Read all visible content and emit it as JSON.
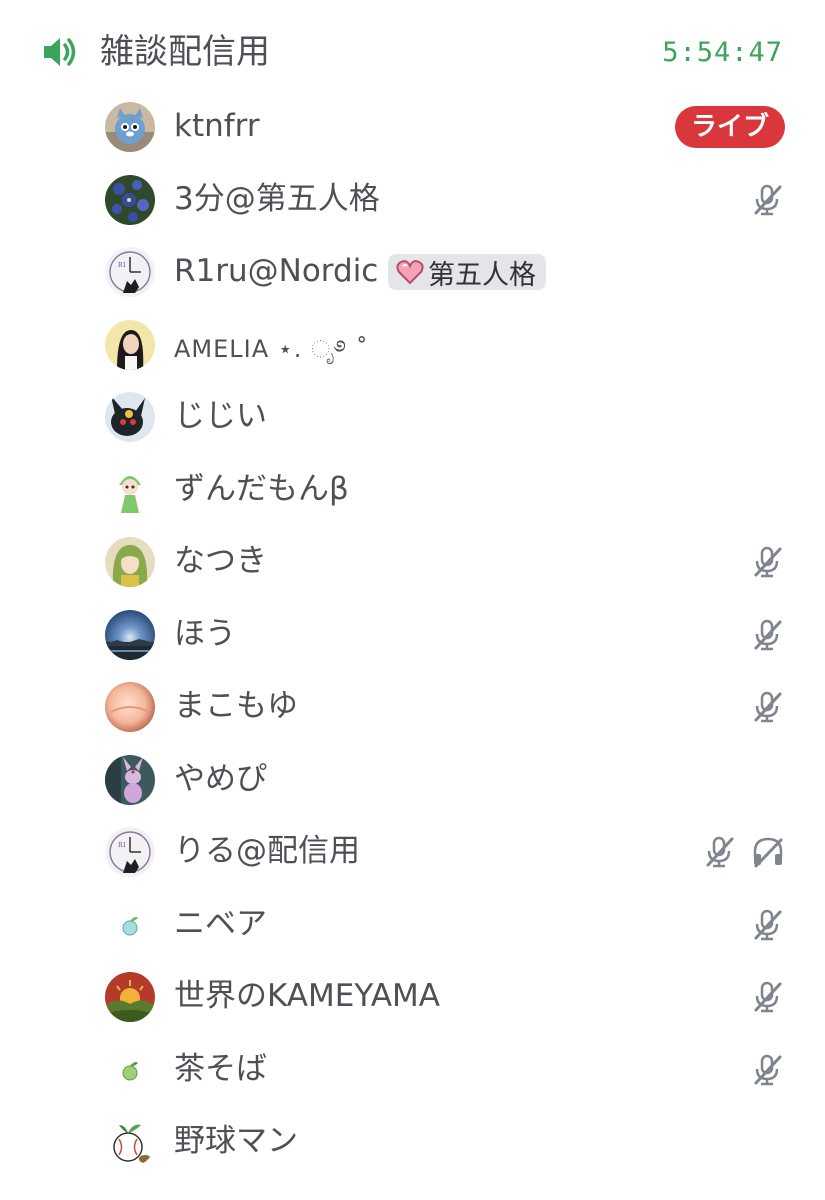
{
  "channel": {
    "icon": "speaker-icon",
    "name": "雑談配信用",
    "timer": "5:54:47",
    "timer_color": "#3ba55c"
  },
  "members": [
    {
      "name": "ktnfrr",
      "badge": "ライブ",
      "badge_color": "#da373c",
      "muted": false,
      "deafened": false,
      "avatar": "cat-plush-avatar"
    },
    {
      "name": "3分@第五人格",
      "muted": true,
      "deafened": false,
      "avatar": "blue-flowers-avatar"
    },
    {
      "name": "R1ru@Nordic",
      "role": "第五人格",
      "role_icon": "pink-heart-icon",
      "muted": false,
      "deafened": false,
      "avatar": "clock-wolf-avatar"
    },
    {
      "name": "AMELIA ⋆. ೃ࿔ ˚",
      "muted": false,
      "deafened": false,
      "avatar": "girl-yellow-avatar"
    },
    {
      "name": "じじい",
      "muted": false,
      "deafened": false,
      "avatar": "umbreon-avatar"
    },
    {
      "name": "ずんだもんβ",
      "muted": false,
      "deafened": false,
      "avatar": "zundamon-avatar"
    },
    {
      "name": "なつき",
      "muted": true,
      "deafened": false,
      "avatar": "green-hair-girl-avatar"
    },
    {
      "name": "ほう",
      "muted": true,
      "deafened": false,
      "avatar": "night-sky-avatar"
    },
    {
      "name": "まこもゆ",
      "muted": true,
      "deafened": false,
      "avatar": "peach-avatar"
    },
    {
      "name": "やめぴ",
      "muted": false,
      "deafened": false,
      "avatar": "espeon-avatar"
    },
    {
      "name": "りる@配信用",
      "muted": true,
      "deafened": true,
      "avatar": "clock-wolf-avatar"
    },
    {
      "name": "ニベア",
      "muted": true,
      "deafened": false,
      "avatar": "mint-sprout-avatar"
    },
    {
      "name": "世界のKAMEYAMA",
      "muted": true,
      "deafened": false,
      "avatar": "sunset-hills-avatar"
    },
    {
      "name": "茶そば",
      "muted": true,
      "deafened": false,
      "avatar": "green-sprout-avatar"
    },
    {
      "name": "野球マン",
      "muted": false,
      "deafened": false,
      "avatar": "baseball-sprout-avatar"
    }
  ],
  "icons": {
    "muted": "mic-off-icon",
    "deafened": "headphones-off-icon"
  }
}
